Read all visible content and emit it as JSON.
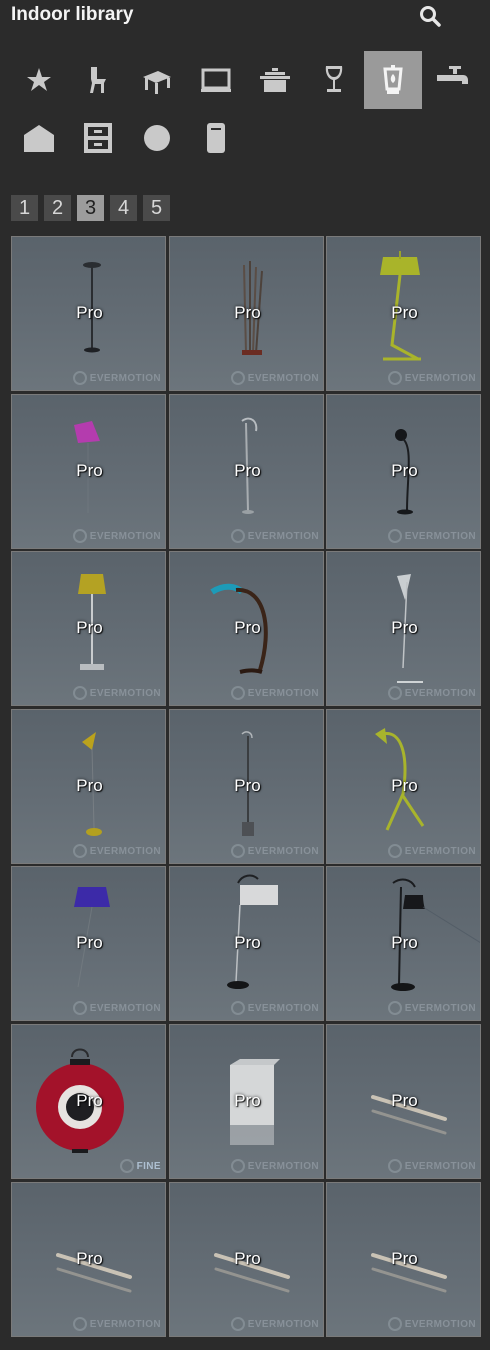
{
  "header": {
    "title": "Indoor library",
    "search_icon": "search-icon"
  },
  "categories": [
    {
      "icon": "star-icon",
      "active": false
    },
    {
      "icon": "chair-icon",
      "active": false
    },
    {
      "icon": "table-icon",
      "active": false
    },
    {
      "icon": "tv-icon",
      "active": false
    },
    {
      "icon": "pot-icon",
      "active": false
    },
    {
      "icon": "wine-glass-icon",
      "active": false
    },
    {
      "icon": "lamp-icon",
      "active": true
    },
    {
      "icon": "faucet-icon",
      "active": false
    },
    {
      "icon": "box-icon",
      "active": false
    },
    {
      "icon": "cabinet-icon",
      "active": false
    },
    {
      "icon": "sphere-icon",
      "active": false
    },
    {
      "icon": "cylinder-icon",
      "active": false
    }
  ],
  "pagination": {
    "pages": [
      "1",
      "2",
      "3",
      "4",
      "5"
    ],
    "current": "3"
  },
  "grid": {
    "badge": "Pro",
    "watermark": "EVERMOTION",
    "items": [
      {
        "badge": "Pro",
        "watermark": "EVERMOTION",
        "art": "torchiere"
      },
      {
        "badge": "Pro",
        "watermark": "EVERMOTION",
        "art": "sticks"
      },
      {
        "badge": "Pro",
        "watermark": "EVERMOTION",
        "art": "green-shade"
      },
      {
        "badge": "Pro",
        "watermark": "EVERMOTION",
        "art": "pink-shade"
      },
      {
        "badge": "Pro",
        "watermark": "EVERMOTION",
        "art": "thin-arc"
      },
      {
        "badge": "Pro",
        "watermark": "EVERMOTION",
        "art": "black-ball"
      },
      {
        "badge": "Pro",
        "watermark": "EVERMOTION",
        "art": "yellow-shade"
      },
      {
        "badge": "Pro",
        "watermark": "EVERMOTION",
        "art": "arc-lamp"
      },
      {
        "badge": "Pro",
        "watermark": "EVERMOTION",
        "art": "white-angled"
      },
      {
        "badge": "Pro",
        "watermark": "EVERMOTION",
        "art": "yellow-cone"
      },
      {
        "badge": "Pro",
        "watermark": "EVERMOTION",
        "art": "tall-thin"
      },
      {
        "badge": "Pro",
        "watermark": "EVERMOTION",
        "art": "green-arm"
      },
      {
        "badge": "Pro",
        "watermark": "EVERMOTION",
        "art": "purple-shade"
      },
      {
        "badge": "Pro",
        "watermark": "EVERMOTION",
        "art": "drum-shade"
      },
      {
        "badge": "Pro",
        "watermark": "EVERMOTION",
        "art": "black-dome"
      },
      {
        "badge": "Pro",
        "watermark": "FINE",
        "art": "lantern"
      },
      {
        "badge": "Pro",
        "watermark": "EVERMOTION",
        "art": "white-box"
      },
      {
        "badge": "Pro",
        "watermark": "EVERMOTION",
        "art": "tube"
      },
      {
        "badge": "Pro",
        "watermark": "EVERMOTION",
        "art": "tube"
      },
      {
        "badge": "Pro",
        "watermark": "EVERMOTION",
        "art": "tube"
      },
      {
        "badge": "Pro",
        "watermark": "EVERMOTION",
        "art": "tube"
      }
    ]
  },
  "colors": {
    "background": "#2b2b2b",
    "active_category": "#9a9a9a",
    "active_page": "#9c9c9c"
  }
}
